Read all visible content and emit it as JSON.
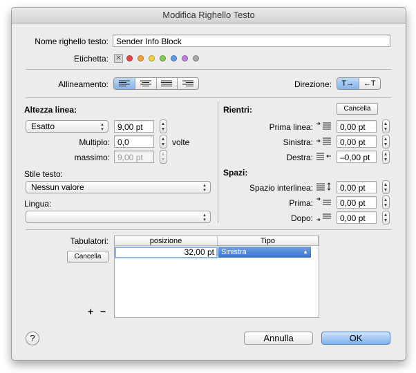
{
  "window": {
    "title": "Modifica Righello Testo"
  },
  "name_row": {
    "label": "Nome righello testo:",
    "value": "Sender Info Block"
  },
  "label_row": {
    "label": "Etichetta:",
    "colors": [
      "#e8434a",
      "#f6a03a",
      "#f3d23e",
      "#7fd04a",
      "#5b9af0",
      "#c07ee0",
      "#a8a8a8"
    ]
  },
  "alignment": {
    "label": "Allineamento:"
  },
  "direction": {
    "label": "Direzione:",
    "ltr": "T→",
    "rtl": "←T"
  },
  "line_height": {
    "title": "Altezza linea:",
    "mode": "Esatto",
    "value": "9,00 pt",
    "multiple_label": "Multiplo:",
    "multiple_value": "0,0",
    "multiple_unit": "volte",
    "max_label": "massimo:",
    "max_value": "9,00 pt"
  },
  "text_style": {
    "label": "Stile testo:",
    "value": "Nessun valore"
  },
  "language": {
    "label": "Lingua:",
    "value": ""
  },
  "indents": {
    "title": "Rientri:",
    "cancel": "Cancella",
    "first_label": "Prima linea:",
    "first_value": "0,00 pt",
    "left_label": "Sinistra:",
    "left_value": "0,00 pt",
    "right_label": "Destra:",
    "right_value": "–0,00 pt"
  },
  "spacing": {
    "title": "Spazi:",
    "line_label": "Spazio interlinea:",
    "line_value": "0,00 pt",
    "before_label": "Prima:",
    "before_value": "0,00 pt",
    "after_label": "Dopo:",
    "after_value": "0,00 pt"
  },
  "tabs": {
    "label": "Tabulatori:",
    "cancel": "Cancella",
    "col_position": "posizione",
    "col_type": "Tipo",
    "rows": [
      {
        "position": "32,00 pt",
        "type": "Sinistra"
      }
    ],
    "add": "+",
    "remove": "−"
  },
  "footer": {
    "help": "?",
    "cancel": "Annulla",
    "ok": "OK"
  }
}
